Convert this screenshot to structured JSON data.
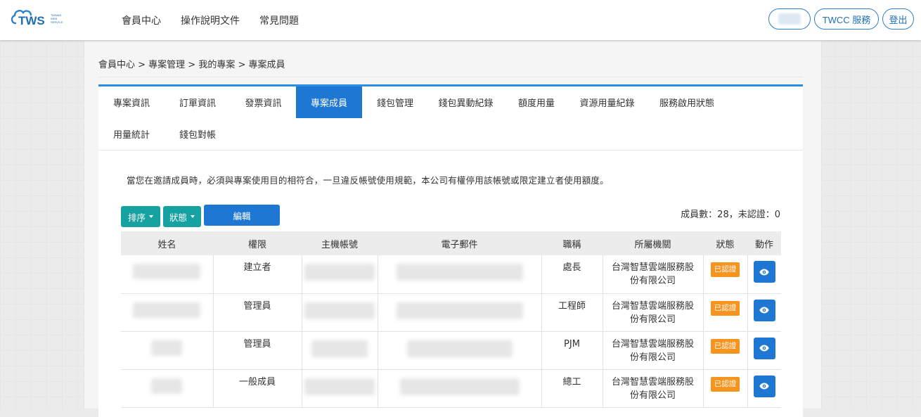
{
  "header": {
    "logo_text": "TWS",
    "logo_sub": [
      "TAIWAN",
      "WEB",
      "SERVICE"
    ],
    "nav": [
      "會員中心",
      "操作說明文件",
      "常見問題"
    ],
    "twcc_label": "TWCC 服務",
    "logout_label": "登出"
  },
  "breadcrumb": "會員中心 > 專案管理 > 我的專案 > 專案成員",
  "tabs": [
    "專案資訊",
    "訂單資訊",
    "發票資訊",
    "專案成員",
    "錢包管理",
    "錢包異動紀錄",
    "額度用量",
    "資源用量紀錄",
    "服務啟用狀態",
    "用量統計",
    "錢包對帳"
  ],
  "active_tab": "專案成員",
  "notice": "當您在邀請成員時，必須與專案使用目的相符合，一旦違反帳號使用規範，本公司有權停用該帳號或限定建立者使用額度。",
  "toolbar": {
    "sort_label": "排序",
    "status_label": "狀態",
    "edit_label": "編輯",
    "member_count": "成員數：28，未認證：0"
  },
  "table": {
    "headers": [
      "姓名",
      "權限",
      "主機帳號",
      "電子郵件",
      "職稱",
      "所屬機關",
      "狀態",
      "動作"
    ],
    "rows": [
      {
        "role": "建立者",
        "title": "處長",
        "org_line1": "台灣智慧雲端服務股",
        "org_line2": "份有限公司",
        "status": "已認證"
      },
      {
        "role": "管理員",
        "title": "工程師",
        "org_line1": "台灣智慧雲端服務股",
        "org_line2": "份有限公司",
        "status": "已認證"
      },
      {
        "role": "管理員",
        "title": "PJM",
        "org_line1": "台灣智慧雲端服務股",
        "org_line2": "份有限公司",
        "status": "已認證"
      },
      {
        "role": "一般成員",
        "title": "總工",
        "org_line1": "台灣智慧雲端服務股",
        "org_line2": "份有限公司",
        "status": "已認證"
      }
    ]
  },
  "colors": {
    "primary": "#1f77d4",
    "teal": "#17a2a2",
    "badge": "#f7941d",
    "tab_border": "#2a8de0"
  }
}
